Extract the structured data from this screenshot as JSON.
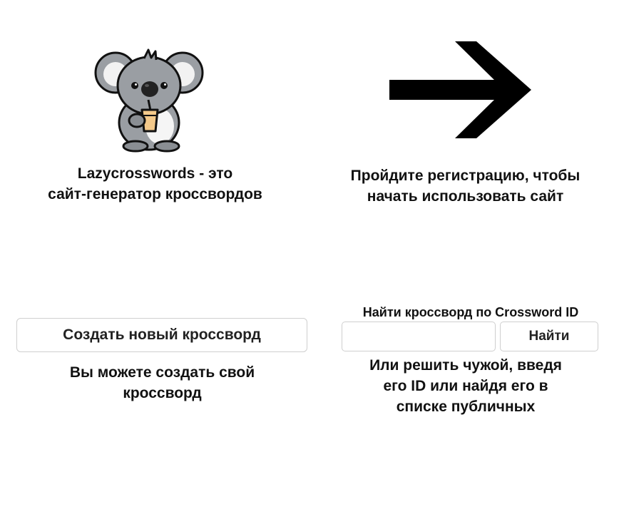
{
  "intro": {
    "caption_line1": "Lazycrosswords - это",
    "caption_line2": "сайт-генератор кроссвордов",
    "koala_icon": "koala-mascot-icon"
  },
  "register": {
    "caption_line1": "Пройдите регистрацию, чтобы",
    "caption_line2": "начать использовать сайт",
    "arrow_icon": "arrow-right-icon"
  },
  "create": {
    "button_label": "Создать новый кроссворд",
    "caption_line1": "Вы можете создать свой",
    "caption_line2": "кроссворд"
  },
  "find": {
    "label": "Найти кроссворд по Crossword ID",
    "input_value": "",
    "input_placeholder": "",
    "button_label": "Найти",
    "caption_line1": "Или решить чужой, введя",
    "caption_line2": "его ID или найдя его в",
    "caption_line3": "списке публичных"
  },
  "colors": {
    "text": "#111111",
    "border": "#cfcfcf",
    "koala_gray": "#9a9ea3",
    "koala_dark": "#5f6368",
    "drink": "#f4c98a"
  }
}
